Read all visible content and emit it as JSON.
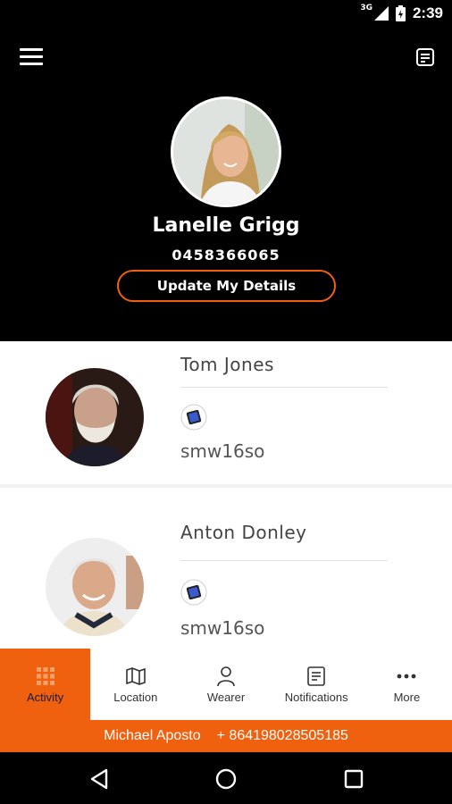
{
  "status_bar": {
    "network": "3G",
    "time": "2:39"
  },
  "profile": {
    "name": "Lanelle Grigg",
    "phone": "0458366065",
    "update_label": "Update My Details"
  },
  "wearers": [
    {
      "name": "Tom Jones",
      "device_id": "smw16so"
    },
    {
      "name": "Anton Donley",
      "device_id": "smw16so"
    }
  ],
  "bottom_nav": [
    {
      "label": "Activity",
      "icon": "grid-icon",
      "active": true
    },
    {
      "label": "Location",
      "icon": "map-icon"
    },
    {
      "label": "Wearer",
      "icon": "person-icon"
    },
    {
      "label": "Notifications",
      "icon": "notes-icon"
    },
    {
      "label": "More",
      "icon": "more-dots-icon"
    }
  ],
  "contact_bar": {
    "name": "Michael Aposto",
    "phone": "+ 864198028505185"
  },
  "colors": {
    "accent": "#f0610f",
    "header_bg": "#000000",
    "text_dark": "#444444"
  }
}
